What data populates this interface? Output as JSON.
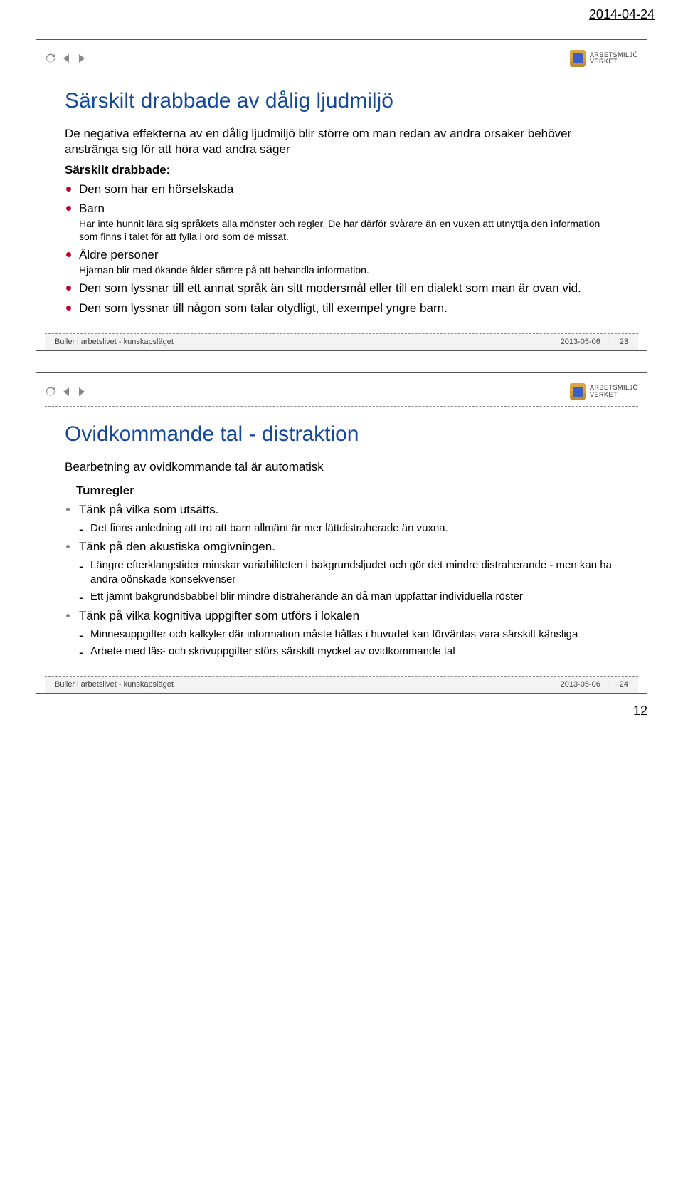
{
  "page": {
    "date": "2014-04-24",
    "pagenum": "12"
  },
  "logo": {
    "line1": "ARBETSMILJÖ",
    "line2": "VERKET"
  },
  "slide1": {
    "title": "Särskilt drabbade av dålig ljudmiljö",
    "lead": "De negativa effekterna av en dålig ljudmiljö blir större om man redan av andra orsaker behöver anstränga sig för att höra vad andra säger",
    "sublead": "Särskilt drabbade:",
    "b1": "Den som har en hörselskada",
    "b2": "Barn",
    "b2note": "Har inte hunnit lära sig språkets alla mönster och regler. De har därför svårare än en vuxen att utnyttja den information som finns i talet för att fylla i ord som de missat.",
    "b3": "Äldre personer",
    "b3note": "Hjärnan blir med ökande ålder sämre på att behandla information.",
    "b4": "Den som lyssnar till ett annat språk än sitt modersmål eller till en dialekt som man är ovan vid.",
    "b5": "Den som lyssnar till någon som talar otydligt, till exempel yngre barn.",
    "footer_left": "Buller i arbetslivet - kunskapsläget",
    "footer_date": "2013-05-06",
    "footer_num": "23"
  },
  "slide2": {
    "title": "Ovidkommande tal - distraktion",
    "lead": "Bearbetning av ovidkommande tal är automatisk",
    "tumregler": "Tumregler",
    "i1": "Tänk på vilka som utsätts.",
    "i1s1": "Det finns anledning att tro att barn allmänt är mer lättdistraherade än vuxna.",
    "i2": "Tänk på den akustiska omgivningen.",
    "i2s1": "Längre efterklangstider minskar variabiliteten i bakgrundsljudet och gör det mindre distraherande - men kan ha andra oönskade konsekvenser",
    "i2s2": "Ett jämnt bakgrundsbabbel blir mindre distraherande än då man uppfattar individuella röster",
    "i3": "Tänk på vilka kognitiva uppgifter som utförs i lokalen",
    "i3s1": "Minnesuppgifter och kalkyler där information måste hållas i huvudet kan förväntas vara särskilt känsliga",
    "i3s2": "Arbete med läs- och skrivuppgifter störs särskilt mycket av ovidkommande tal",
    "footer_left": "Buller i arbetslivet - kunskapsläget",
    "footer_date": "2013-05-06",
    "footer_num": "24"
  }
}
